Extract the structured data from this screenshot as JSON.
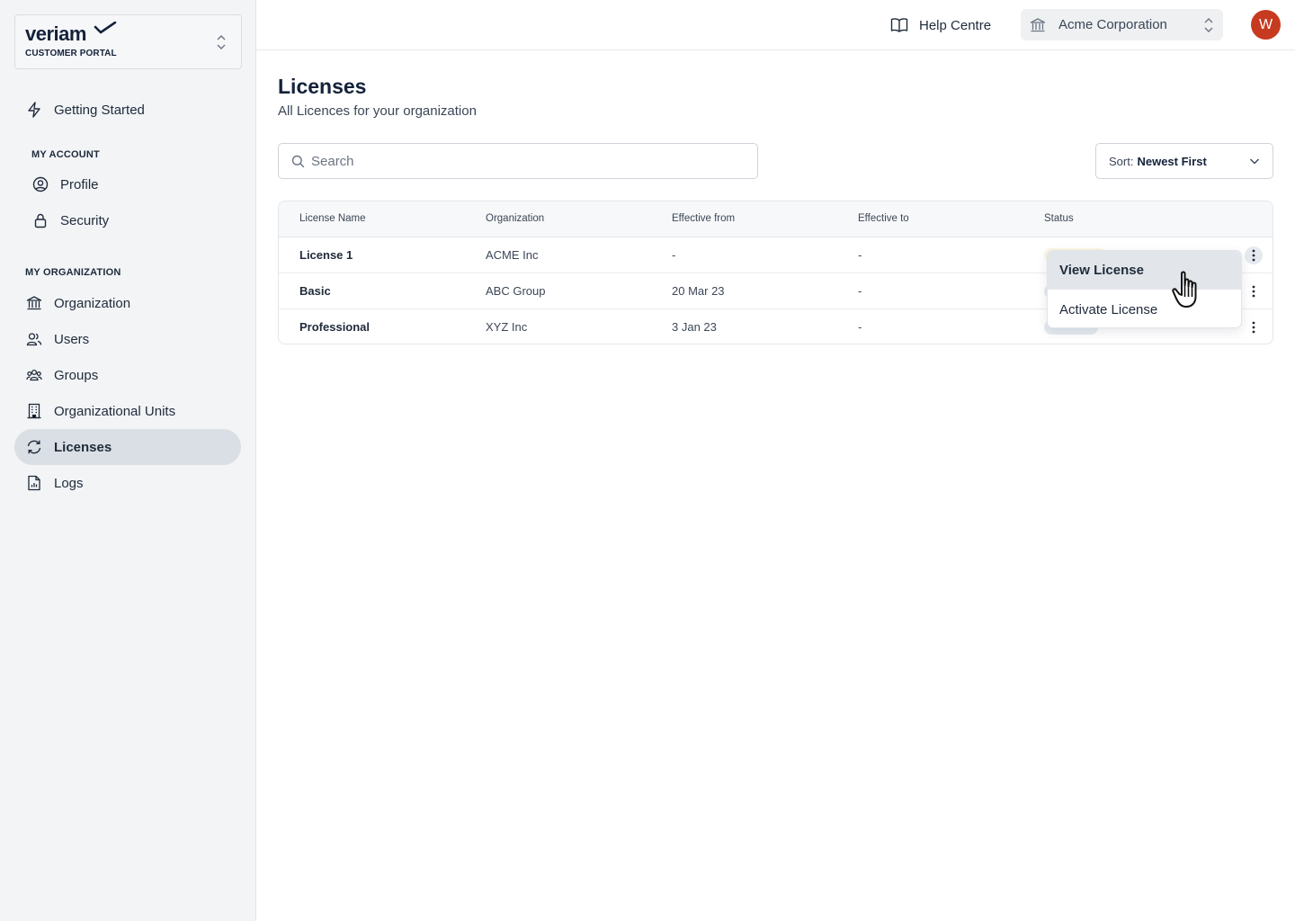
{
  "brand": {
    "name": "veriam",
    "subtitle": "CUSTOMER PORTAL"
  },
  "sidebar": {
    "getting_started": "Getting Started",
    "my_account_label": "MY ACCOUNT",
    "account_items": [
      {
        "label": "Profile"
      },
      {
        "label": "Security"
      }
    ],
    "my_org_label": "MY ORGANIZATION",
    "org_items": [
      {
        "label": "Organization"
      },
      {
        "label": "Users"
      },
      {
        "label": "Groups"
      },
      {
        "label": "Organizational Units"
      },
      {
        "label": "Licenses",
        "active": true
      },
      {
        "label": "Logs"
      }
    ]
  },
  "header": {
    "help_label": "Help Centre",
    "org_name": "Acme Corporation",
    "avatar_initial": "W"
  },
  "main": {
    "title": "Licenses",
    "subtitle": "All Licences for your organization",
    "search_placeholder": "Search",
    "sort_prefix": "Sort:",
    "sort_value": "Newest First"
  },
  "table": {
    "columns": [
      "License Name",
      "Organization",
      "Effective from",
      "Effective to",
      "Status"
    ],
    "rows": [
      {
        "name": "License 1",
        "organization": "ACME Inc",
        "effective_from": "-",
        "effective_to": "-"
      },
      {
        "name": "Basic",
        "organization": "ABC Group",
        "effective_from": "20 Mar 23",
        "effective_to": "-"
      },
      {
        "name": "Professional",
        "organization": "XYZ Inc",
        "effective_from": "3 Jan 23",
        "effective_to": "-"
      }
    ]
  },
  "menu": {
    "items": [
      {
        "label": "View License"
      },
      {
        "label": "Activate License"
      }
    ]
  },
  "colors": {
    "accent": "#14223a",
    "avatar": "#c63a1f",
    "active_nav": "#d9dfe5"
  }
}
